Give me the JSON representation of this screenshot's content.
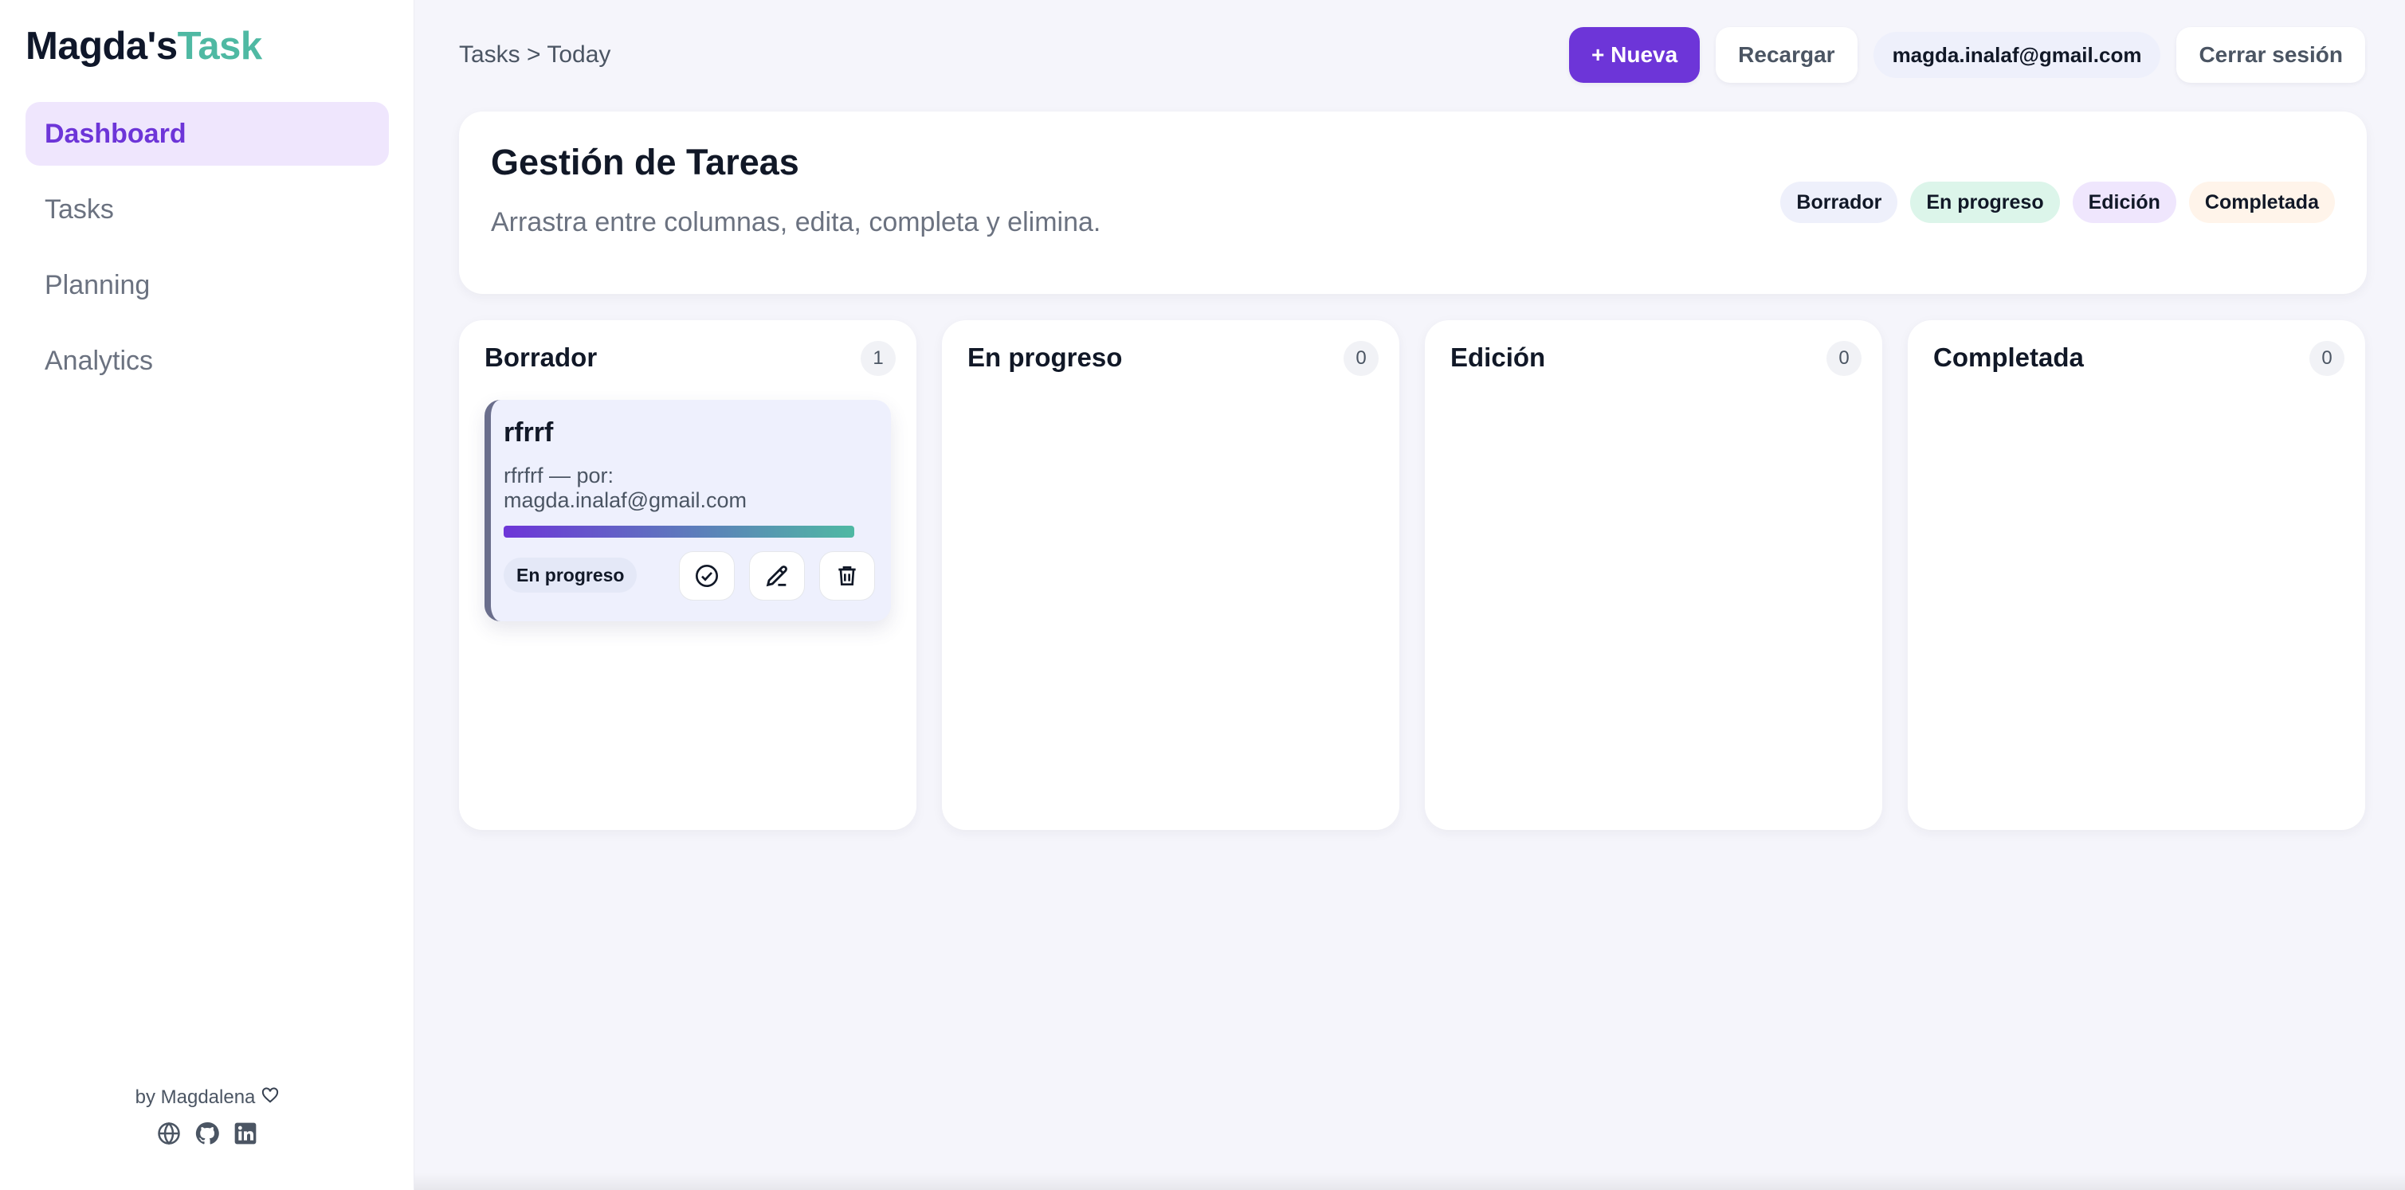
{
  "brand": {
    "part1": "Magda's",
    "part2": "Task"
  },
  "sidebar": {
    "items": [
      {
        "label": "Dashboard",
        "active": true
      },
      {
        "label": "Tasks"
      },
      {
        "label": "Planning"
      },
      {
        "label": "Analytics"
      }
    ],
    "credit": "by Magdalena",
    "social_icons": [
      "globe-icon",
      "github-icon",
      "linkedin-icon"
    ]
  },
  "breadcrumb": "Tasks > Today",
  "topbar": {
    "new_label": "+ Nueva",
    "reload_label": "Recargar",
    "user_email": "magda.inalaf@gmail.com",
    "logout_label": "Cerrar sesión"
  },
  "header": {
    "title": "Gestión de Tareas",
    "subtitle": "Arrastra entre columnas, edita, completa y elimina.",
    "legend": [
      {
        "label": "Borrador",
        "color": "#eef0fb"
      },
      {
        "label": "En progreso",
        "color": "#dcf5ea"
      },
      {
        "label": "Edición",
        "color": "#efe6fd"
      },
      {
        "label": "Completada",
        "color": "#fff4ea"
      }
    ]
  },
  "columns": [
    {
      "title": "Borrador",
      "count": "1"
    },
    {
      "title": "En progreso",
      "count": "0"
    },
    {
      "title": "Edición",
      "count": "0"
    },
    {
      "title": "Completada",
      "count": "0"
    }
  ],
  "task": {
    "title": "rfrrf",
    "description": "rfrfrf — por: magda.inalaf@gmail.com",
    "progress": 1.0,
    "status": "En progreso",
    "actions": [
      "check-circle-icon",
      "pencil-icon",
      "trash-icon"
    ]
  },
  "colors": {
    "accent": "#6d35d8",
    "brand_teal": "#4fb9a3"
  }
}
